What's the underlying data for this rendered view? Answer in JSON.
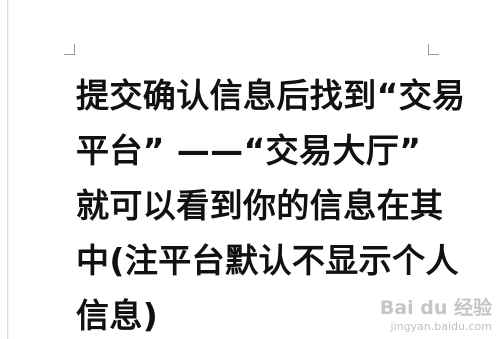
{
  "document": {
    "lines": [
      "提交确认信息后找到“交易",
      "平台” ——“交易大厅”",
      "就可以看到你的信息在其",
      "中(注平台默认不显示个人",
      "信息)"
    ]
  },
  "watermark": {
    "logo_text": "Bai du 经验",
    "url": "jingyan.baidu.com"
  }
}
